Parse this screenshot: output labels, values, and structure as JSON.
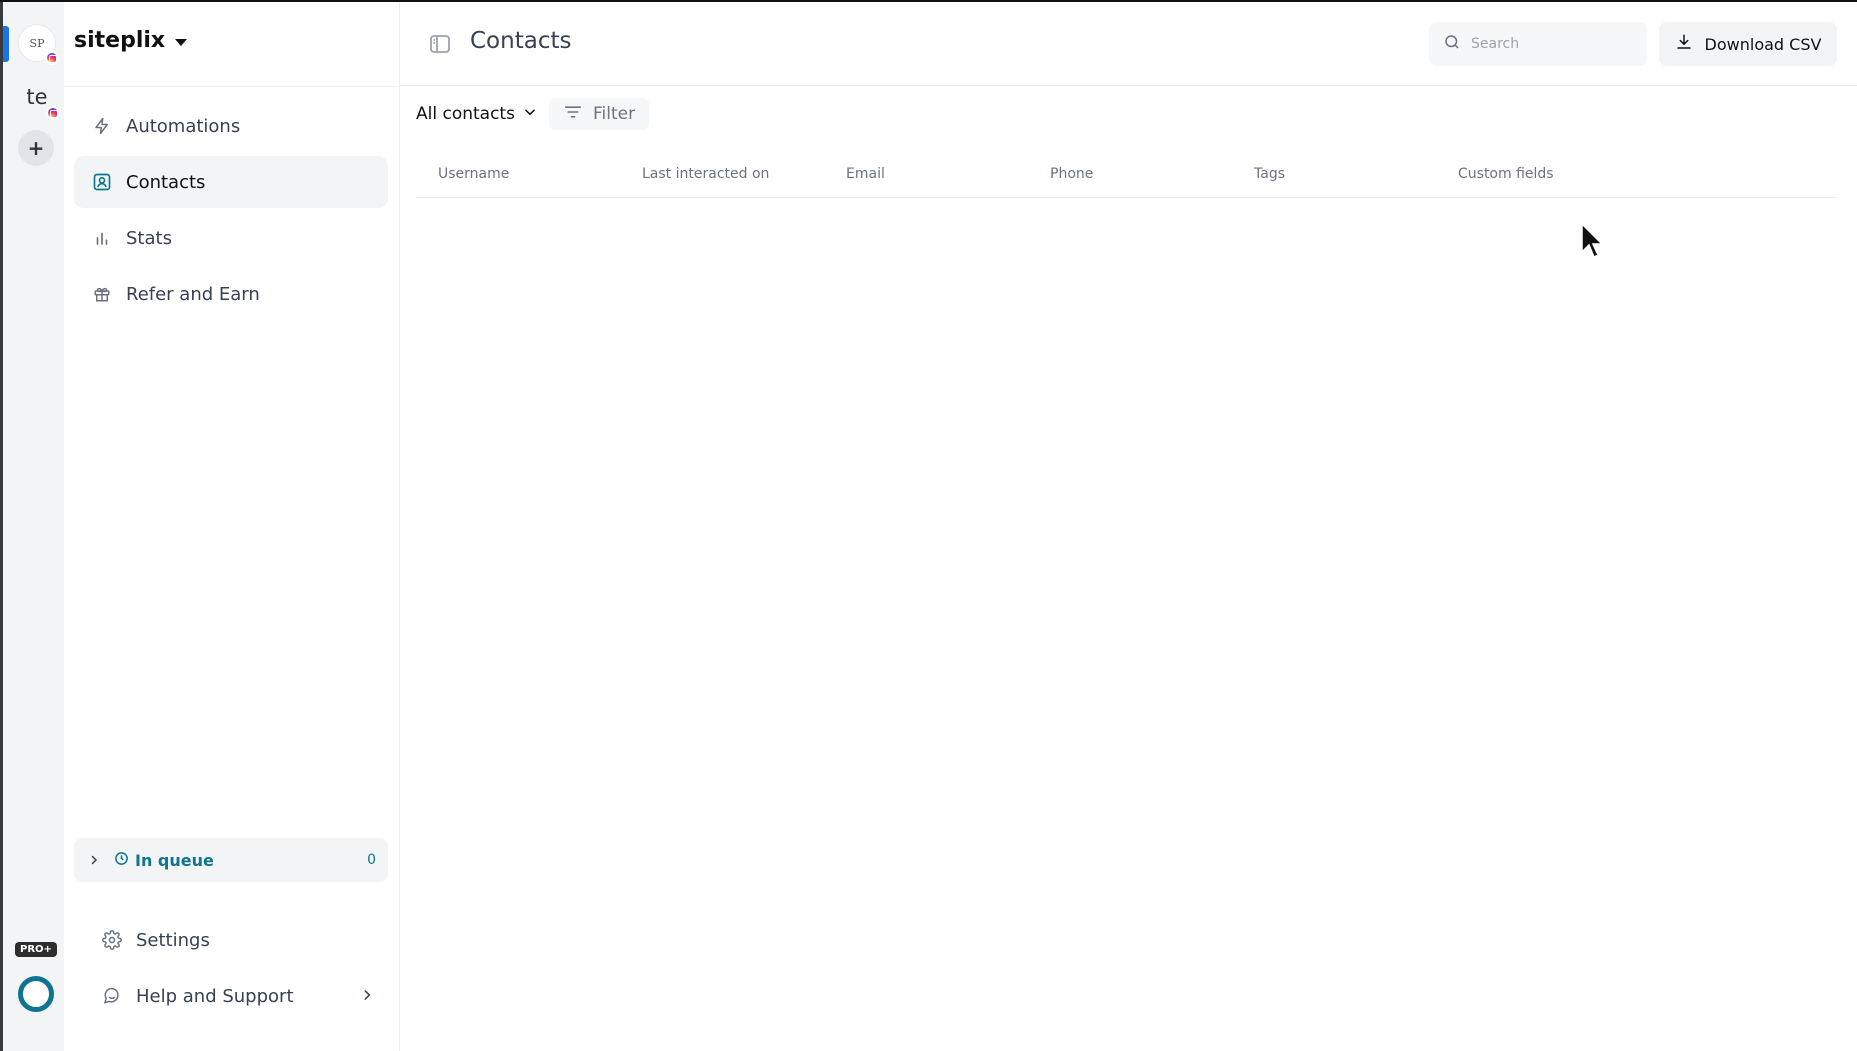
{
  "rail": {
    "accounts": [
      {
        "logo_text": "SP",
        "badge": "instagram"
      },
      {
        "initials": "te",
        "badge": "instagram"
      }
    ],
    "add_label": "+",
    "plan_badge": "PRO+"
  },
  "sidebar": {
    "workspace_name": "siteplix",
    "nav": [
      {
        "label": "Automations",
        "icon": "lightning-icon",
        "active": false
      },
      {
        "label": "Contacts",
        "icon": "contact-card-icon",
        "active": true
      },
      {
        "label": "Stats",
        "icon": "bar-chart-icon",
        "active": false
      },
      {
        "label": "Refer and Earn",
        "icon": "gift-icon",
        "active": false
      }
    ],
    "queue": {
      "label": "In queue",
      "count": "0"
    },
    "bottom": [
      {
        "label": "Settings",
        "icon": "gear-icon"
      },
      {
        "label": "Help and Support",
        "icon": "help-chat-icon"
      }
    ]
  },
  "header": {
    "title": "Contacts",
    "search_placeholder": "Search",
    "download_label": "Download CSV"
  },
  "toolbar": {
    "view_label": "All contacts",
    "filter_label": "Filter"
  },
  "table": {
    "columns": [
      "Username",
      "Last interacted on",
      "Email",
      "Phone",
      "Tags",
      "Custom fields"
    ],
    "rows": []
  },
  "colors": {
    "accent": "#0e7490",
    "active_bg": "#f3f4f6",
    "border": "#eceef1"
  }
}
